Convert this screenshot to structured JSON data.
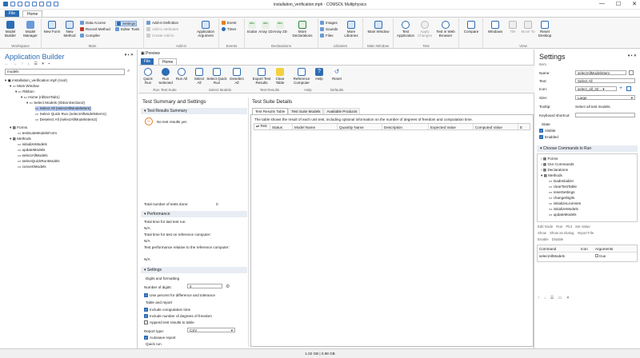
{
  "window": {
    "title": "installation_verification.mph - COMSOL Multiphysics",
    "minimize": "—",
    "maximize": "☐",
    "close": "✕"
  },
  "tabs": {
    "file": "File",
    "home": "Home"
  },
  "ribbon": {
    "workspace": {
      "label": "Workspace",
      "model_builder": "Model Builder",
      "model_manager": "Model Manager"
    },
    "main": {
      "label": "Main",
      "new_form": "New Form",
      "new_method": "New Method",
      "data_access": "Data Access",
      "record_method": "Record Method",
      "compiler": "Compiler",
      "settings": "Settings",
      "editor_tools": "Editor Tools"
    },
    "addin": {
      "label": "Add-in",
      "add_in_definition": "Add-in Definition",
      "add_to_attributes": "Add to Attributes",
      "create_add_in": "Create Add-in",
      "application_argument": "Application Argument"
    },
    "events": {
      "label": "Events",
      "event": "Event",
      "timer": "Timer"
    },
    "declarations": {
      "label": "Declarations",
      "scalar": "Scalar",
      "array1d": "Array 1D",
      "array2d": "Array 2D",
      "more": "More Declarations"
    },
    "libraries": {
      "label": "Libraries",
      "images": "Images",
      "sounds": "Sounds",
      "files": "Files",
      "more": "More Libraries"
    },
    "main_window": {
      "label": "Main Window",
      "main_window": "Main Window"
    },
    "test": {
      "label": "Test",
      "test_application": "Test Application",
      "apply_changes": "Apply Changes",
      "test_in_web": "Test in Web Browser"
    },
    "compare": {
      "compare": "Compare"
    },
    "view": {
      "label": "View",
      "windows": "Windows",
      "tile": "Tile",
      "move_to": "Move To",
      "reset_desktop": "Reset Desktop"
    }
  },
  "app_builder": {
    "title": "Application Builder",
    "search": "models",
    "tree": [
      "installation_verification.mph (root)",
      "Main Window",
      "Ribbon",
      "Home (ribbonTab1)",
      "Select Models (ribbonSection2)",
      "Select All (selectAllModelsItem)",
      "Select Quick Run (selectAllModelsItem1)",
      "Deselect All (selectAllModelsItem2)",
      "Forms",
      "testSuiteModelsForm",
      "Methods",
      "initializeModels",
      "updateModels",
      "selectAllModels",
      "selectQuickRunModels",
      "convertModels"
    ]
  },
  "preview": {
    "title": "Preview",
    "tabs": {
      "file": "File",
      "home": "Home"
    },
    "buttons": {
      "quick_run": "Quick Run",
      "run_selected": "Run Selected",
      "run_all": "Run All",
      "select_all": "Select All",
      "select_quick_run": "Select Quick Run",
      "deselect_all": "Deselect All",
      "export_test_results": "Export Test Results",
      "clear_table": "Clear Table",
      "reference_computer": "Reference Computer",
      "help": "Help",
      "reset": "Reset"
    },
    "groups": {
      "run_test_suite": "Run Test Suite",
      "select_models": "Select Models",
      "test_results": "Test Results",
      "help": "Help",
      "defaults": "Defaults"
    }
  },
  "summary": {
    "title": "Test Summary and Settings",
    "results_summary": "Test Results Summary",
    "no_results": "No test results yet.",
    "total_tests_label": "Total number of tests done:",
    "total_tests": "0",
    "performance": "Performance",
    "perf1": "Total time for last test run:",
    "perf1_val": "N/A",
    "perf2": "Total time for test on reference computer:",
    "perf2_val": "N/A",
    "perf3": "Test performance relative to the reference computer:",
    "perf3_val": "N/A",
    "settings": "Settings",
    "digits_formatting": "Digits and formatting",
    "num_digits_label": "Number of digits:",
    "num_digits": "4",
    "use_percent": "Use percent for difference and tolerance",
    "table_report": "Table and report",
    "include_computation_time": "Include computation time",
    "include_dof": "Include number of degrees of freedom",
    "append_results": "Append test results to table",
    "report_type_label": "Report type:",
    "report_type": "CSV",
    "autosave": "Autosave report",
    "quick_run": "Quick run",
    "quick_run_threshold_label": "Quick run threshold (s):",
    "quick_run_threshold": "25",
    "stop_test_suite": "Stop test suite",
    "stop_if_fails": "Stop test suite if one test fails"
  },
  "details": {
    "title": "Test Suite Details",
    "tabs": [
      "Test Results Table",
      "Test Suite Models",
      "Available Products"
    ],
    "description": "The table shows the result of each unit test, including optional information on the number of degrees of freedom and computation time.",
    "columns": [
      "Test",
      "Status",
      "Model Name",
      "Quantity Name",
      "Description",
      "Expected Value",
      "Computed Value",
      "E"
    ]
  },
  "settings": {
    "title": "Settings",
    "subtitle": "Item",
    "name_label": "Name:",
    "name": "selectAllModelsItem",
    "text_label": "Text:",
    "text": "Select All",
    "icon_label": "Icon:",
    "icon": "select_all_32...",
    "size_label": "Size:",
    "size": "Large",
    "tooltip_label": "Tooltip:",
    "tooltip": "Select all test models.",
    "keyboard_label": "Keyboard shortcut:",
    "state": "State",
    "visible": "Visible",
    "enabled": "Enabled",
    "choose_commands": "Choose Commands to Run",
    "cmd_tree": [
      "Forms",
      "GUI Commands",
      "Declarations",
      "Methods",
      "loadInitialize",
      "clearTestTable",
      "resetSettings",
      "changeDigits",
      "initializeLicenses",
      "initializeModels",
      "updateModels"
    ],
    "actions": [
      "Edit Node",
      "Run",
      "Plot",
      "Set Value",
      "Show",
      "Show as Dialog",
      "Import File",
      "Enable",
      "Disable"
    ],
    "table_cols": [
      "Command",
      "Icon",
      "Arguments"
    ],
    "table_row": {
      "command": "selectAllModels",
      "icon": "",
      "arguments": "true"
    }
  },
  "status": {
    "memory": "1.02 GB | 0.98 GB"
  }
}
